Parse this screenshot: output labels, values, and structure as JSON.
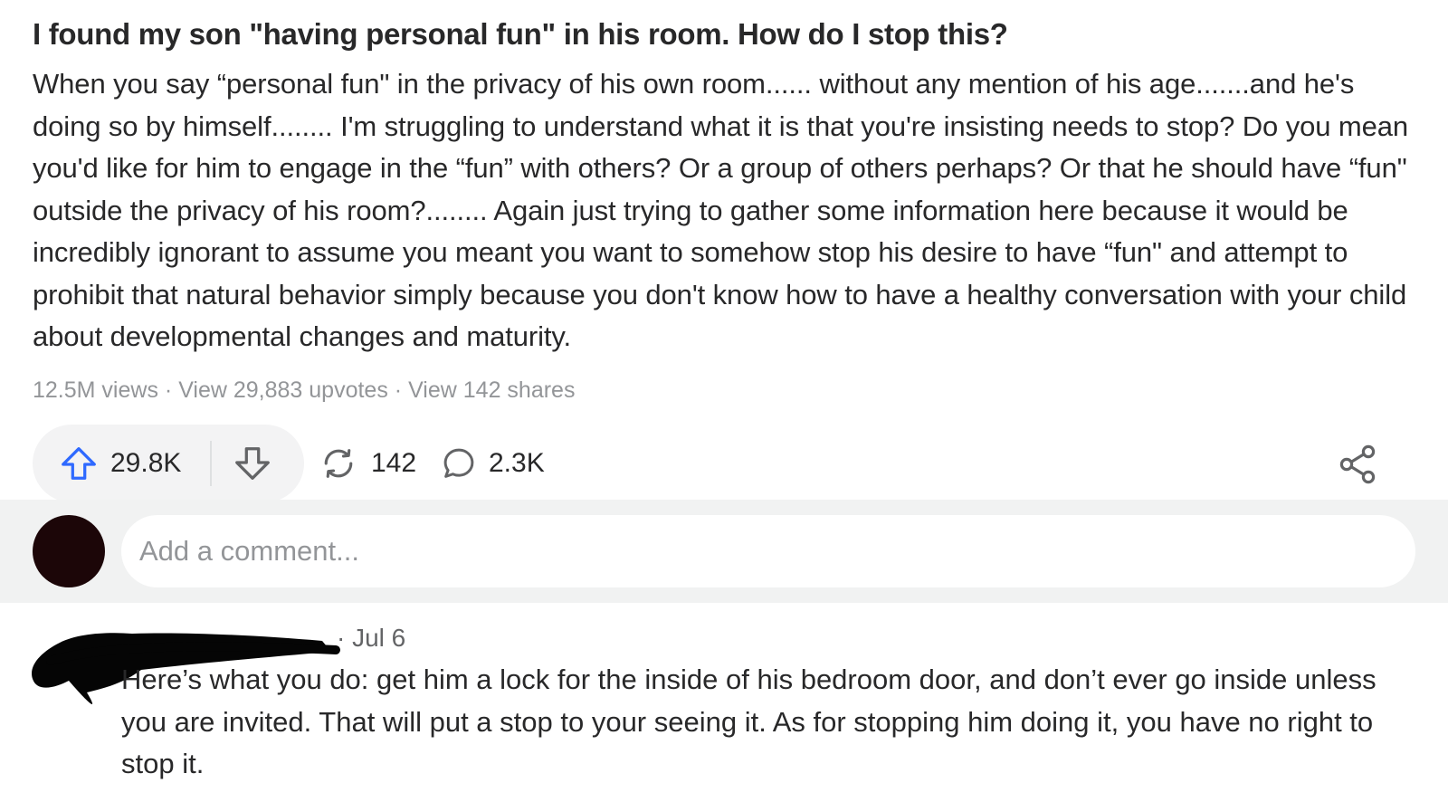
{
  "question": {
    "title": "I found my son \"having personal fun\" in his room. How do I stop this?"
  },
  "answer": {
    "body": "When you say “personal fun\" in the privacy of his own room...... without any mention of his age.......and he's doing so by himself........ I'm struggling to understand what it is that you're insisting needs to stop? Do you mean you'd like for him to engage in the “fun” with others? Or a group of others perhaps? Or that he should have “fun\" outside the privacy of his room?........ Again just trying to gather some information here because it would be incredibly ignorant to assume you meant you want to somehow stop his desire to have “fun\" and attempt to prohibit that natural behavior simply because you don't know how to have a healthy conversation with your child about developmental changes and maturity.",
    "views": "12.5M views",
    "separator": "·",
    "upvotes_link": "View 29,883 upvotes",
    "shares_link": "View 142 shares"
  },
  "actions": {
    "upvote_count": "29.8K",
    "share_count": "142",
    "comment_count": "2.3K",
    "icons": [
      "upvote-arrow-icon",
      "downvote-arrow-icon",
      "reshare-icon",
      "comment-bubble-icon",
      "share-network-icon"
    ],
    "colors": {
      "upvote": "#2e69ff",
      "icon": "#636466"
    }
  },
  "composer": {
    "placeholder": "Add a comment...",
    "avatar_color": "#1c0608"
  },
  "comment": {
    "date": "· Jul 6",
    "text": "Here’s what you do: get him a lock for the inside of his bedroom door, and don’t ever go inside unless you are invited. That will put a stop to your seeing it. As for stopping him doing it, you have no right to stop it."
  }
}
